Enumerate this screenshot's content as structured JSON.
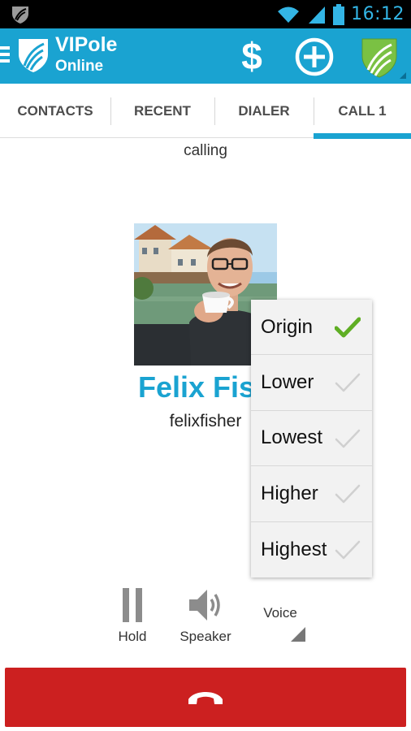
{
  "status_bar": {
    "time": "16:12",
    "icons": [
      "vipole-notification-icon",
      "wifi-icon",
      "signal-icon",
      "battery-icon"
    ]
  },
  "action_bar": {
    "title": "VIPole",
    "subtitle": "Online",
    "dollar_symbol": "$",
    "icons": [
      "menu-icon",
      "vipole-logo-icon",
      "dollar-icon",
      "add-icon",
      "shield-icon"
    ]
  },
  "tabs": [
    {
      "label": "CONTACTS",
      "active": false
    },
    {
      "label": "RECENT",
      "active": false
    },
    {
      "label": "DIALER",
      "active": false
    },
    {
      "label": "CALL 1",
      "active": true
    }
  ],
  "call": {
    "status": "calling",
    "contact_name": "Felix Fish",
    "contact_login": "felixfisher"
  },
  "voice_menu": {
    "items": [
      {
        "label": "Origin",
        "selected": true
      },
      {
        "label": "Lower",
        "selected": false
      },
      {
        "label": "Lowest",
        "selected": false
      },
      {
        "label": "Higher",
        "selected": false
      },
      {
        "label": "Highest",
        "selected": false
      }
    ]
  },
  "controls": {
    "hold": "Hold",
    "speaker": "Speaker",
    "voice": "Voice"
  },
  "colors": {
    "accent": "#1aa3d1",
    "hangup": "#cc2020",
    "check_selected": "#5fae24",
    "check_unselected": "#d0d0d0"
  }
}
